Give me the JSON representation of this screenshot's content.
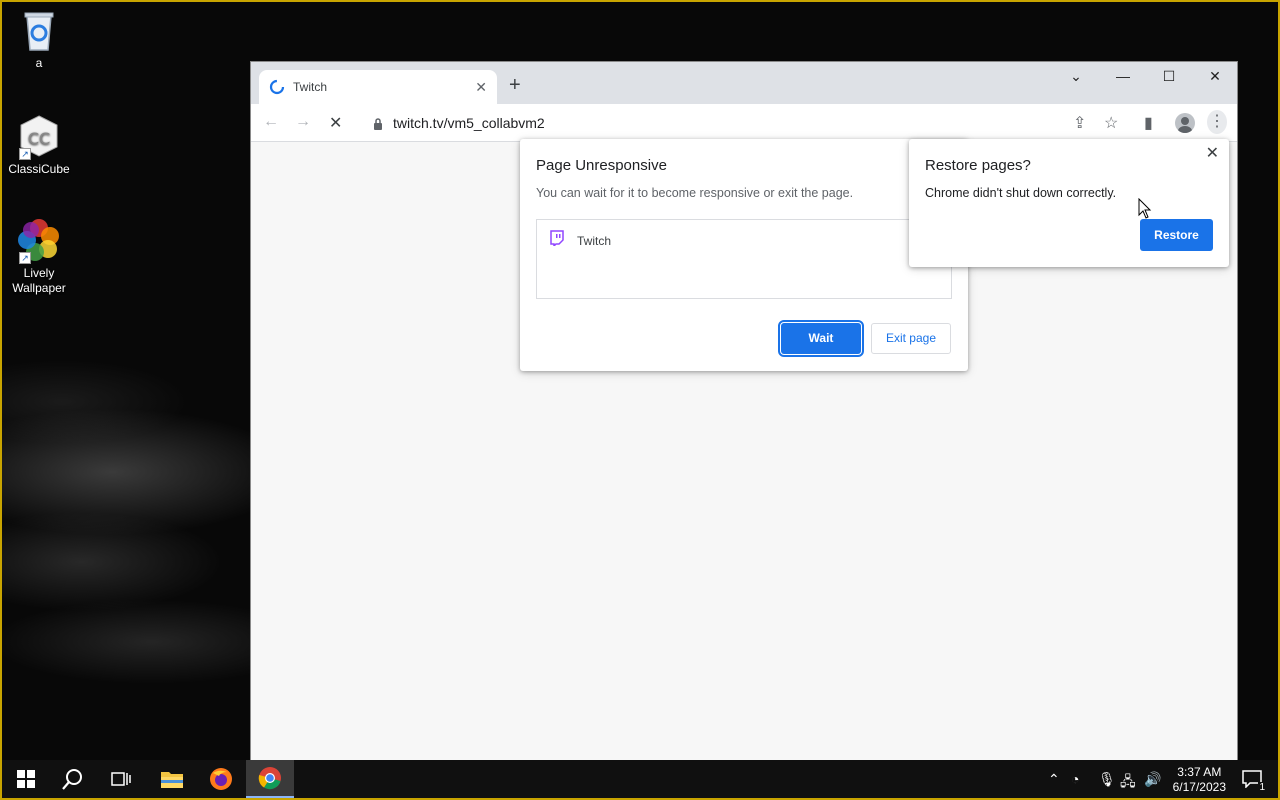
{
  "desktop": {
    "icons": [
      {
        "label": "a",
        "icon": "recycle-bin-icon"
      },
      {
        "label": "ClassiCube",
        "icon": "classicube-icon"
      },
      {
        "label": "Lively Wallpaper",
        "icon": "lively-wallpaper-icon"
      }
    ]
  },
  "browser": {
    "tab_title": "Twitch",
    "url": "twitch.tv/vm5_collabvm2"
  },
  "unresponsive_dialog": {
    "title": "Page Unresponsive",
    "message": "You can wait for it to become responsive or exit the page.",
    "page_item": "Twitch",
    "wait_label": "Wait",
    "exit_label": "Exit page"
  },
  "restore_bubble": {
    "title": "Restore pages?",
    "message": "Chrome didn't shut down correctly.",
    "restore_label": "Restore"
  },
  "taskbar": {
    "time": "3:37 AM",
    "date": "6/17/2023",
    "notification_count": "1"
  },
  "colors": {
    "accent": "#1a73e8",
    "twitch": "#9146ff"
  }
}
